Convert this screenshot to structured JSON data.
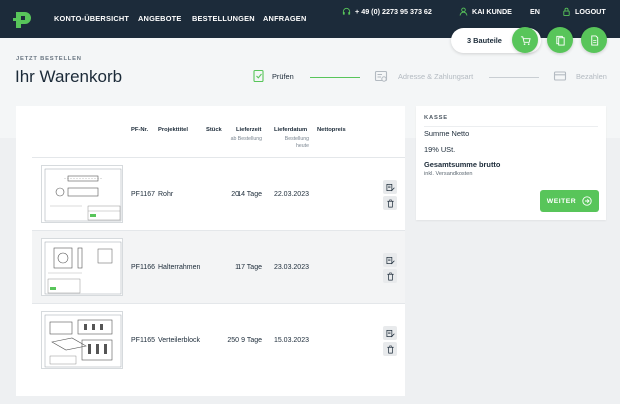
{
  "nav": {
    "items": [
      "KONTO-ÜBERSICHT",
      "ANGEBOTE",
      "BESTELLUNGEN",
      "ANFRAGEN"
    ],
    "phone": "+ 49 (0) 2273 95 373 62",
    "user": "KAI KUNDE",
    "lang": "EN",
    "logout": "LOGOUT"
  },
  "header": {
    "kicker": "JETZT BESTELLEN",
    "title": "Ihr Warenkorb"
  },
  "cart": {
    "count_label": "3 Bauteile"
  },
  "steps": [
    {
      "label": "Prüfen",
      "active": true
    },
    {
      "label": "Adresse & Zahlungsart",
      "active": false
    },
    {
      "label": "Bezahlen",
      "active": false
    }
  ],
  "table": {
    "headers": {
      "pf": "PF-Nr.",
      "title": "Projekttitel",
      "qty": "Stück",
      "lead": "Lieferzeit",
      "lead_sub": "ab Bestellung",
      "date": "Lieferdatum",
      "date_sub": "Bestellung heute",
      "price": "Nettopreis"
    },
    "rows": [
      {
        "pf": "PF1167",
        "title": "Rohr",
        "qty": "20",
        "lead": "14 Tage",
        "date": "22.03.2023"
      },
      {
        "pf": "PF1166",
        "title": "Halterrahmen",
        "qty": "1",
        "lead": "17 Tage",
        "date": "23.03.2023"
      },
      {
        "pf": "PF1165",
        "title": "Verteilerblock",
        "qty": "250",
        "lead": "9 Tage",
        "date": "15.03.2023"
      }
    ]
  },
  "kasse": {
    "title": "KASSE",
    "net": "Summe Netto",
    "vat": "19% USt.",
    "gross": "Gesamtsumme brutto",
    "shipping": "inkl. Versandkosten",
    "button": "WEITER"
  },
  "colors": {
    "nav_bg": "#1c2b3a",
    "accent": "#58c55a"
  }
}
